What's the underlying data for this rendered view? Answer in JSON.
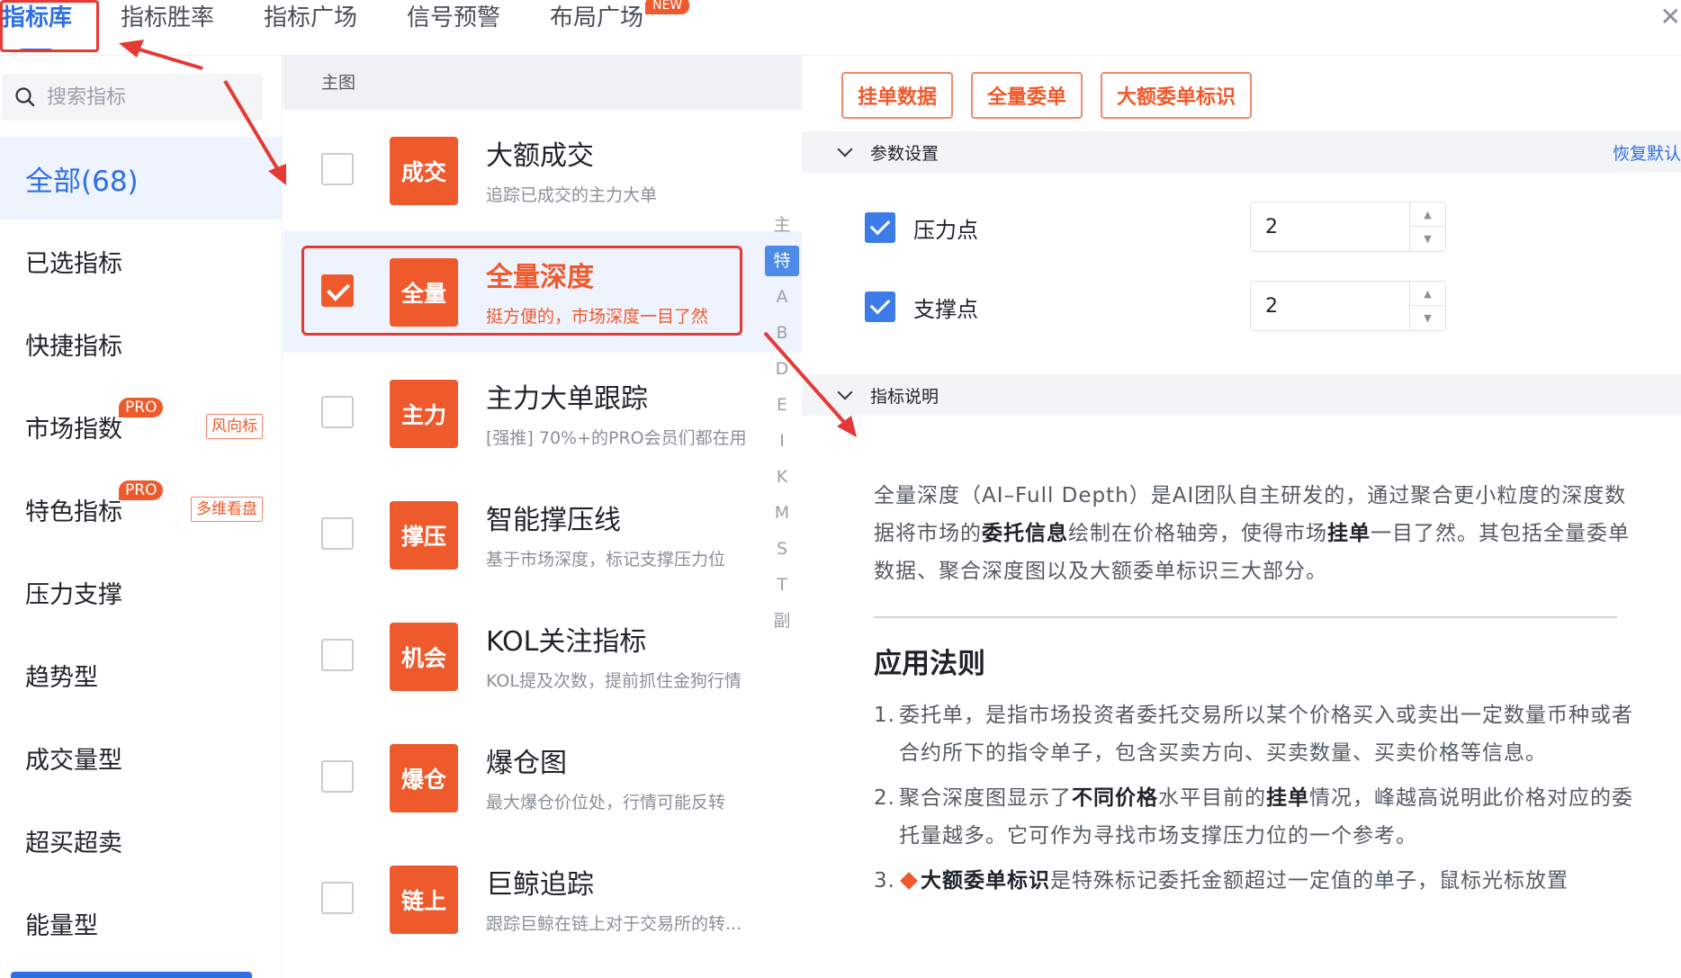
{
  "tabs": [
    {
      "label": "指标库",
      "active": true
    },
    {
      "label": "指标胜率",
      "active": false
    },
    {
      "label": "指标广场",
      "active": false
    },
    {
      "label": "信号预警",
      "active": false
    },
    {
      "label": "布局广场",
      "active": false
    }
  ],
  "new_badge": "NEW",
  "search": {
    "placeholder": "搜索指标"
  },
  "categories": [
    {
      "label": "全部(68)",
      "active": true
    },
    {
      "label": "已选指标"
    },
    {
      "label": "快捷指标"
    },
    {
      "label": "市场指数",
      "pro": "PRO",
      "tag": "风向标"
    },
    {
      "label": "特色指标",
      "pro": "PRO",
      "tag": "多维看盘"
    },
    {
      "label": "压力支撑"
    },
    {
      "label": "趋势型"
    },
    {
      "label": "成交量型"
    },
    {
      "label": "超买超卖"
    },
    {
      "label": "能量型"
    }
  ],
  "list_header": "主图",
  "indicators": [
    {
      "badge": "成交",
      "title": "大额成交",
      "desc": "追踪已成交的主力大单",
      "checked": false
    },
    {
      "badge": "全量",
      "title": "全量深度",
      "desc": "挺方便的，市场深度一目了然",
      "checked": true
    },
    {
      "badge": "主力",
      "title": "主力大单跟踪",
      "desc": "[强推] 70%+的PRO会员们都在用",
      "checked": false
    },
    {
      "badge": "撑压",
      "title": "智能撑压线",
      "desc": "基于市场深度，标记支撑压力位",
      "checked": false
    },
    {
      "badge": "机会",
      "title": "KOL关注指标",
      "desc": "KOL提及次数，提前抓住金狗行情",
      "checked": false
    },
    {
      "badge": "爆仓",
      "title": "爆仓图",
      "desc": "最大爆仓价位处，行情可能反转",
      "checked": false
    },
    {
      "badge": "链上",
      "title": "巨鲸追踪",
      "desc": "跟踪巨鲸在链上对于交易所的转...",
      "checked": false
    }
  ],
  "alphabet": [
    "主",
    "特",
    "A",
    "B",
    "D",
    "E",
    "I",
    "K",
    "M",
    "S",
    "T",
    "副"
  ],
  "alphabet_active": "特",
  "detail": {
    "buttons": [
      "挂单数据",
      "全量委单",
      "大额委单标识"
    ],
    "param_section": "参数设置",
    "reset": "恢复默认",
    "params": [
      {
        "label": "压力点",
        "value": "2"
      },
      {
        "label": "支撑点",
        "value": "2"
      }
    ],
    "desc_section": "指标说明",
    "desc": {
      "p1": "全量深度（AI–Full Depth）是AI团队自主研发的，通过聚合更小粒度的深度数据将市场的",
      "b1": "委托信息",
      "p2": "绘制在价格轴旁，使得市场",
      "b2": "挂单",
      "p3": "一目了然。其包括全量委单数据、聚合深度图以及大额委单标识三大部分。"
    },
    "rules_title": "应用法则",
    "rules": {
      "r1_num": "1.",
      "r1": "委托单，是指市场投资者委托交易所以某个价格买入或卖出一定数量币种或者合约所下的指令单子，包含买卖方向、买卖数量、买卖价格等信息。",
      "r2_num": "2.",
      "r2a": "聚合深度图显示了",
      "r2b": "不同价格",
      "r2c": "水平目前的",
      "r2d": "挂单",
      "r2e": "情况，峰越高说明此价格对应的委托量越多。它可作为寻找市场支撑压力位的一个参考。",
      "r3_num": "3.",
      "r3b": "大额委单标识",
      "r3c": "是特殊标记委托金额超过一定值的单子，鼠标光标放置"
    }
  },
  "colors": {
    "accent": "#2f6fe4",
    "brand": "#ef5a2c",
    "annotation": "#e53935"
  }
}
